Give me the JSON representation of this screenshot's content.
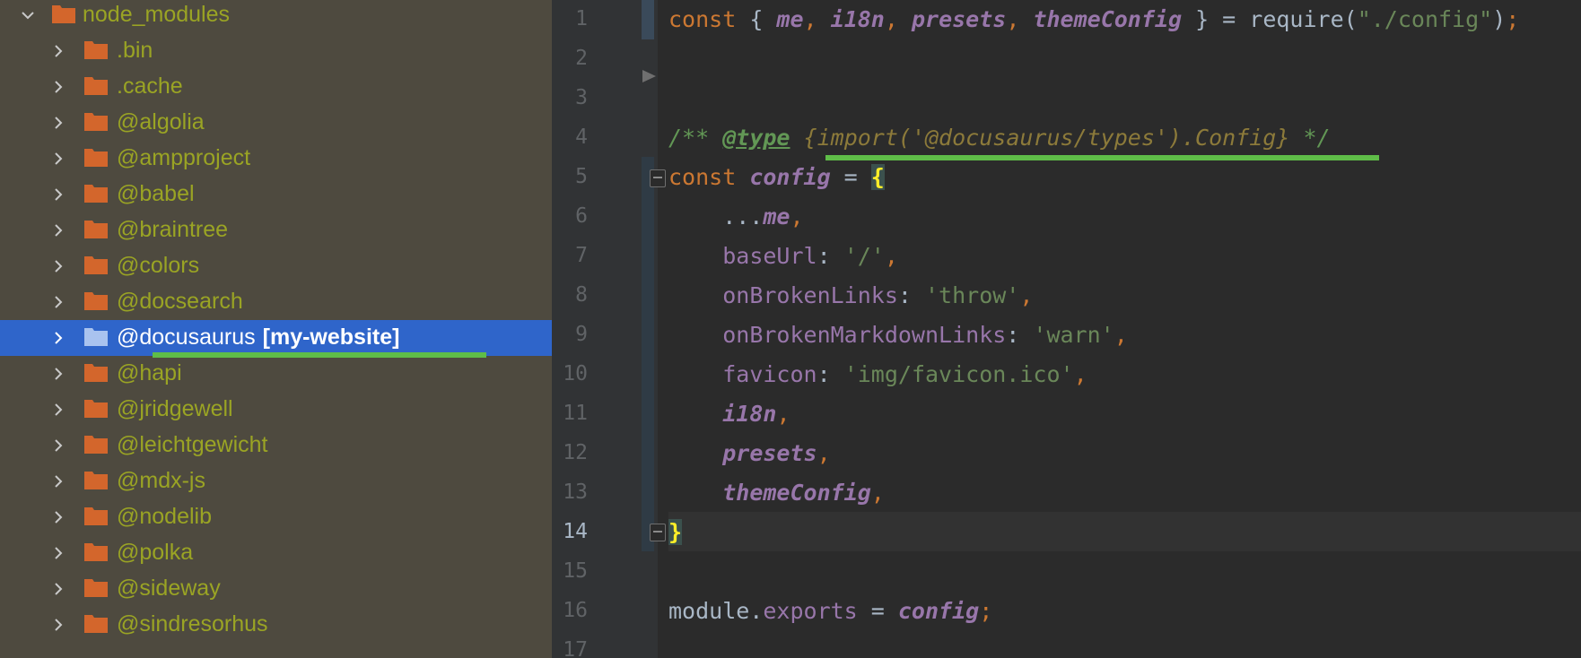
{
  "project_tree": {
    "root": {
      "label": "node_modules",
      "expanded": true
    },
    "items": [
      {
        "label": ".bin"
      },
      {
        "label": ".cache"
      },
      {
        "label": "@algolia"
      },
      {
        "label": "@ampproject"
      },
      {
        "label": "@babel"
      },
      {
        "label": "@braintree"
      },
      {
        "label": "@colors"
      },
      {
        "label": "@docsearch"
      },
      {
        "label": "@docusaurus",
        "extra": "[my-website]",
        "selected": true
      },
      {
        "label": "@hapi"
      },
      {
        "label": "@jridgewell"
      },
      {
        "label": "@leichtgewicht"
      },
      {
        "label": "@mdx-js"
      },
      {
        "label": "@nodelib"
      },
      {
        "label": "@polka"
      },
      {
        "label": "@sideway"
      },
      {
        "label": "@sindresorhus"
      }
    ]
  },
  "editor": {
    "current_line": 14,
    "line_numbers": [
      "1",
      "2",
      "3",
      "4",
      "5",
      "6",
      "7",
      "8",
      "9",
      "10",
      "11",
      "12",
      "13",
      "14",
      "15",
      "16",
      "17"
    ]
  },
  "colors": {
    "sidebar_bg": "#4e4a3f",
    "tree_text": "#9aa424",
    "selection": "#2f65ca",
    "editor_bg": "#2b2b2b",
    "green_underline": "#5fbd48"
  }
}
